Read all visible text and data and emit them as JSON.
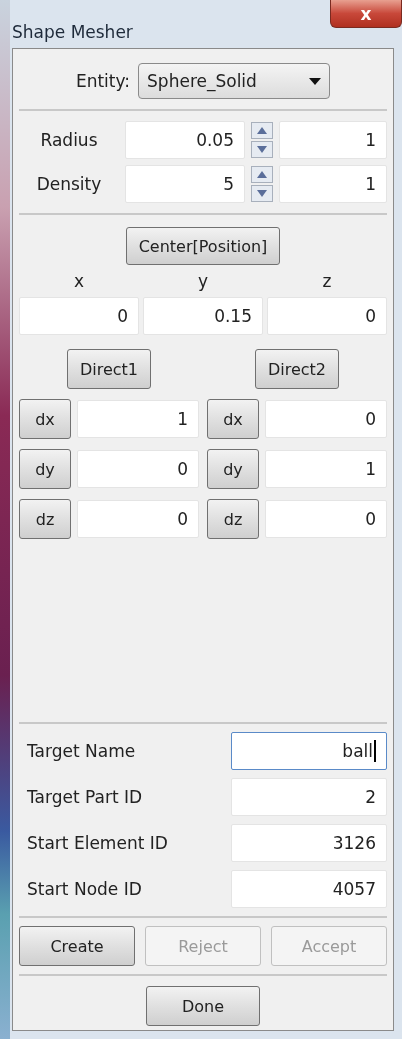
{
  "window": {
    "title": "Shape Mesher",
    "close": "x"
  },
  "entity": {
    "label": "Entity:",
    "value": "Sphere_Solid"
  },
  "parameters": [
    {
      "label": "Radius",
      "value": "0.05",
      "step": "1"
    },
    {
      "label": "Density",
      "value": "5",
      "step": "1"
    }
  ],
  "center": {
    "button": "Center[Position]",
    "axes": [
      "x",
      "y",
      "z"
    ],
    "values": [
      "0",
      "0.15",
      "0"
    ]
  },
  "directions": [
    {
      "button": "Direct1",
      "rows": [
        {
          "label": "dx",
          "value": "1"
        },
        {
          "label": "dy",
          "value": "0"
        },
        {
          "label": "dz",
          "value": "0"
        }
      ]
    },
    {
      "button": "Direct2",
      "rows": [
        {
          "label": "dx",
          "value": "0"
        },
        {
          "label": "dy",
          "value": "1"
        },
        {
          "label": "dz",
          "value": "0"
        }
      ]
    }
  ],
  "target_fields": [
    {
      "label": "Target Name",
      "value": "ball",
      "focused": true
    },
    {
      "label": "Target Part ID",
      "value": "2",
      "focused": false
    },
    {
      "label": "Start Element ID",
      "value": "3126",
      "focused": false
    },
    {
      "label": "Start Node ID",
      "value": "4057",
      "focused": false
    }
  ],
  "actions": [
    {
      "label": "Create",
      "disabled": false
    },
    {
      "label": "Reject",
      "disabled": true
    },
    {
      "label": "Accept",
      "disabled": true
    }
  ],
  "done": "Done"
}
